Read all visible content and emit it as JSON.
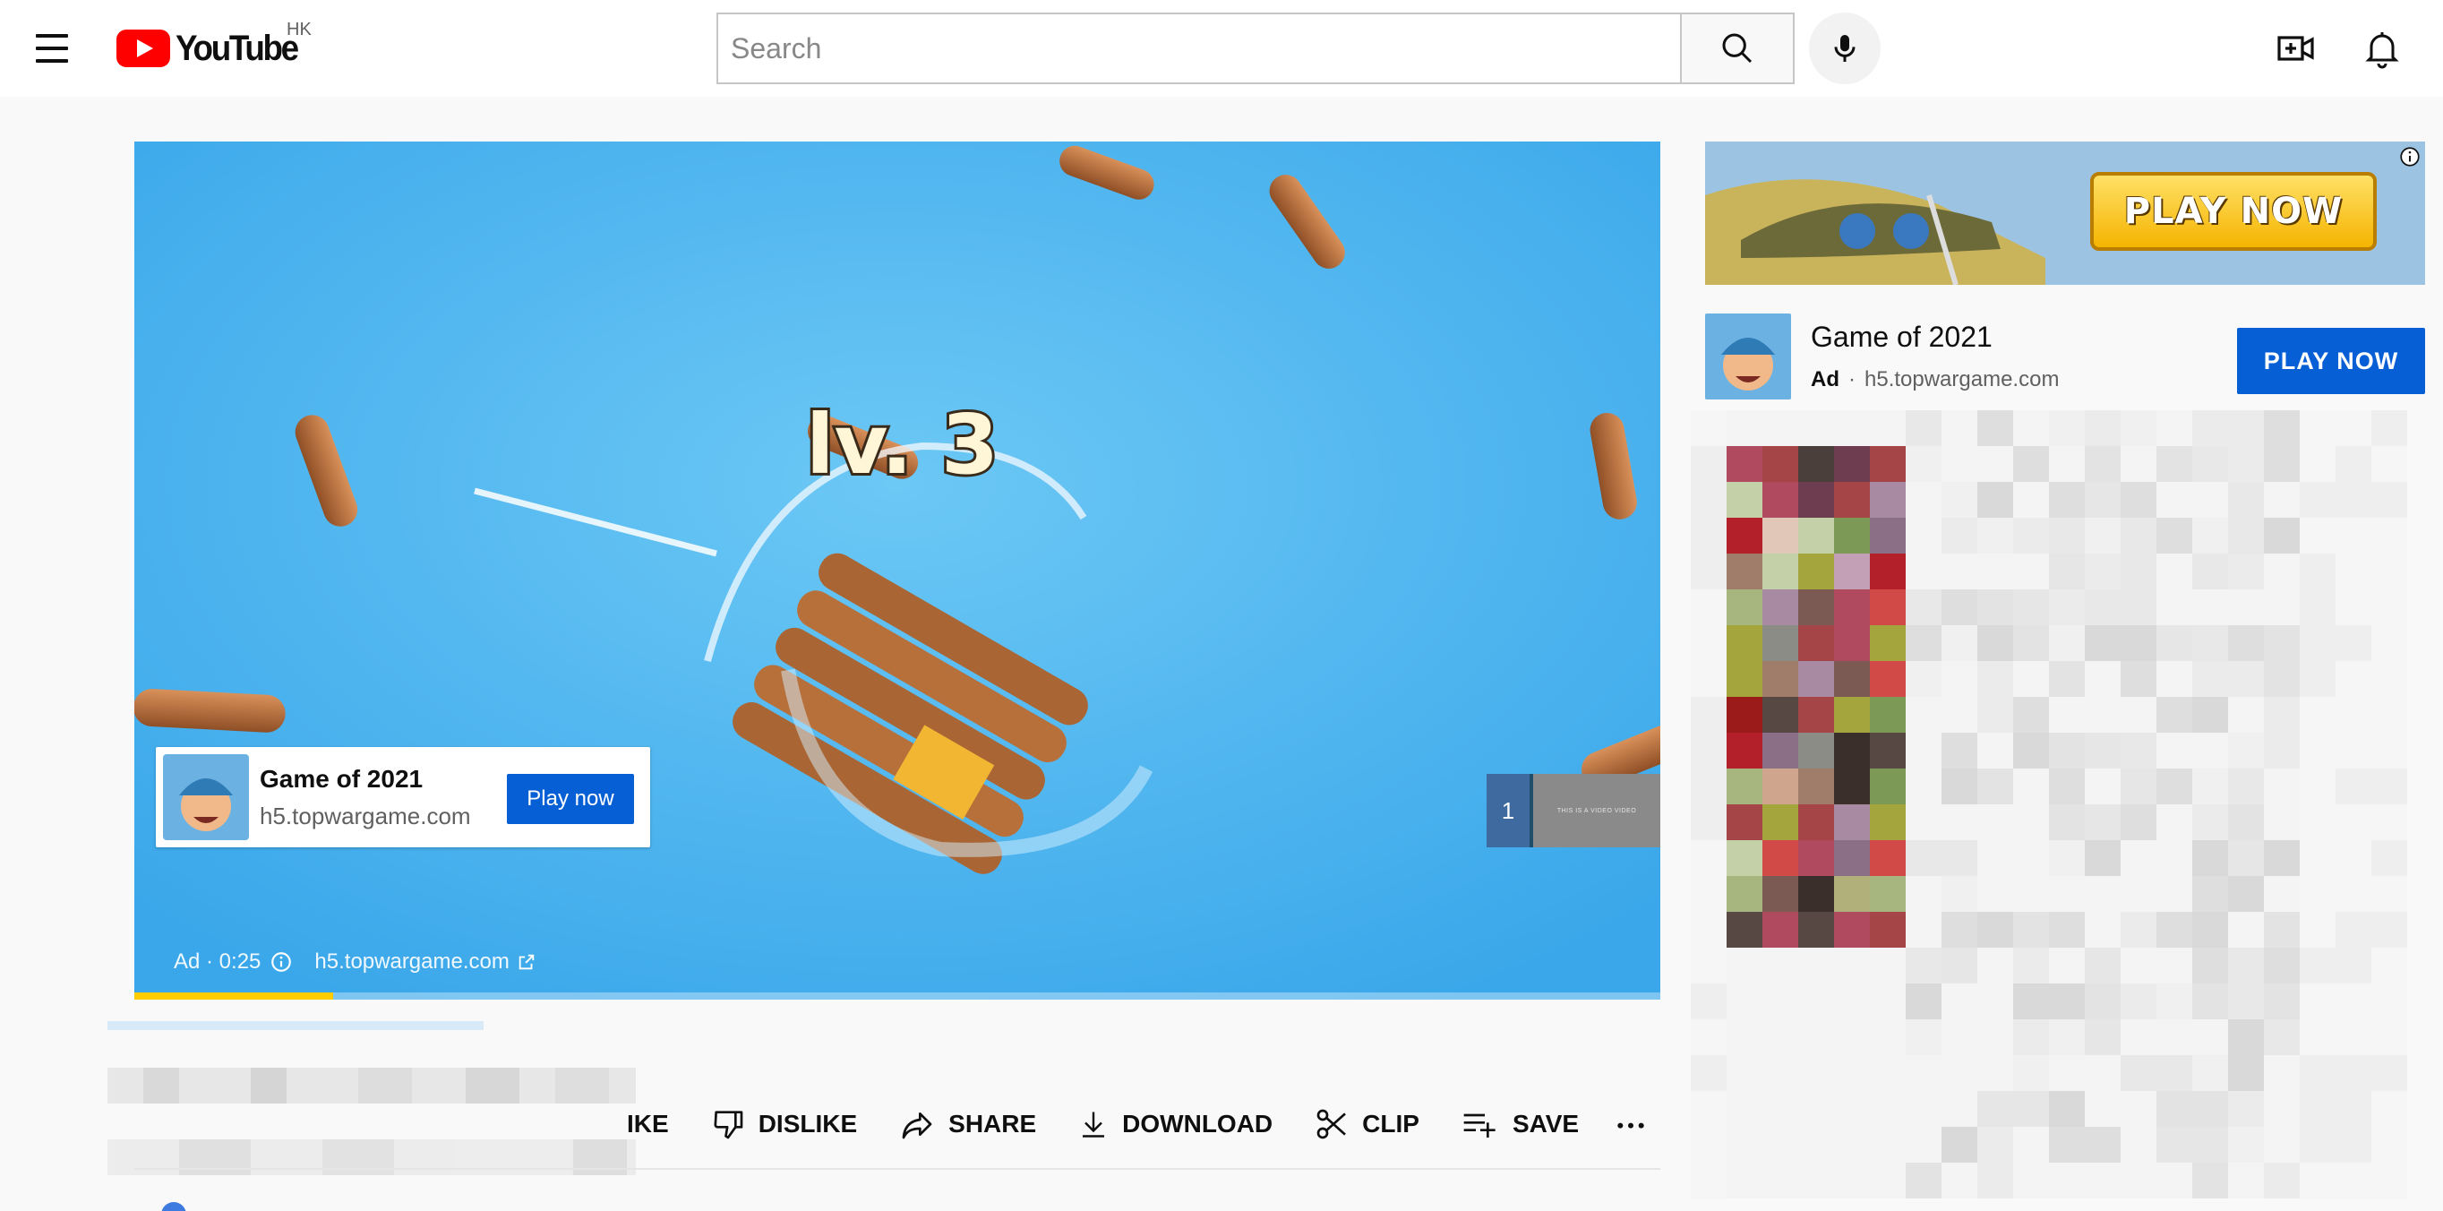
{
  "header": {
    "logo_text": "YouTube",
    "region": "HK",
    "search_placeholder": "Search",
    "icons": [
      "menu-icon",
      "search-icon",
      "microphone-icon",
      "create-video-icon",
      "notifications-icon"
    ]
  },
  "player": {
    "overlay_ad": {
      "title": "Game of 2021",
      "domain": "h5.topwargame.com",
      "cta": "Play now"
    },
    "ad_bar": {
      "label": "Ad · 0:25",
      "domain": "h5.topwargame.com"
    },
    "skip_preview": {
      "count": "1",
      "thumb_text": "THIS IS A VIDEO VIDEO"
    },
    "progress_fraction": 0.13
  },
  "actions": [
    {
      "label": "IKE",
      "icon": "like-icon"
    },
    {
      "label": "DISLIKE",
      "icon": "dislike-icon"
    },
    {
      "label": "SHARE",
      "icon": "share-icon"
    },
    {
      "label": "DOWNLOAD",
      "icon": "download-icon"
    },
    {
      "label": "CLIP",
      "icon": "scissors-icon"
    },
    {
      "label": "SAVE",
      "icon": "playlist-add-icon"
    }
  ],
  "sidebar_ad": {
    "banner_cta": "PLAY NOW",
    "title": "Game of 2021",
    "badge": "Ad",
    "domain": "h5.topwargame.com",
    "cta": "PLAY NOW"
  },
  "colors": {
    "brand_red": "#ff0000",
    "cta_blue": "#065fd4",
    "progress_yellow": "#ffcc00",
    "water_blue": "#4bb2ee"
  }
}
